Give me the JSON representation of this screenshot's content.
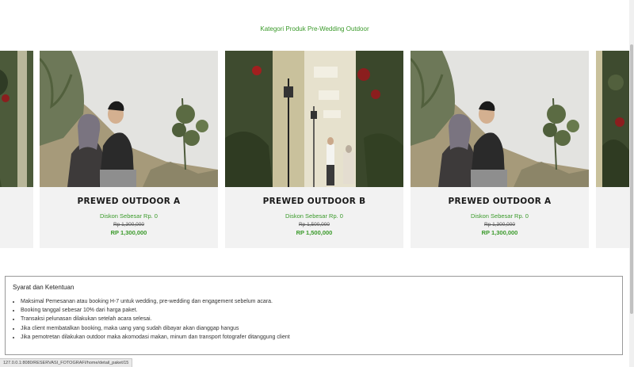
{
  "page": {
    "heading": "Kategori Produk Pre-Wedding Outdoor"
  },
  "products": [
    {
      "title": "PREWED OUTDOOR A",
      "discount": "Diskon Sebesar Rp. 0",
      "old_price": "Rp 1,300,000",
      "price": "RP 1,300,000",
      "photo": "couple-sitting-hillside"
    },
    {
      "title": "PREWED OUTDOOR B",
      "discount": "Diskon Sebesar Rp. 0",
      "old_price": "Rp 1,500,000",
      "price": "RP 1,500,000",
      "photo": "couple-standing-street-lamps"
    },
    {
      "title": "PREWED OUTDOOR A",
      "discount": "Diskon Sebesar Rp. 0",
      "old_price": "Rp 1,300,000",
      "price": "RP 1,300,000",
      "photo": "couple-sitting-hillside"
    }
  ],
  "terms": {
    "title": "Syarat dan Ketentuan",
    "items": [
      "Maksimal Pemesanan atau booking H-7 untuk wedding, pre-wedding dan engagement sebelum acara.",
      "Booking tanggal sebesar 10% dari harga paket.",
      "Transaksi pelunasan dilakukan setelah acara selesai.",
      "Jika client membatalkan booking, maka uang yang sudah dibayar akan dianggap hangus",
      "Jika pemotretan dilakukan outdoor maka akomodasi makan, minum dan transport fotografer ditanggung client"
    ]
  },
  "status_bar": {
    "url": "127.0.0.1:8080/RESERVASI_FOTOGRAFI/home/detail_paket/15"
  },
  "colors": {
    "accent_green": "#3a9a2a",
    "card_bg": "#f2f2f2"
  }
}
